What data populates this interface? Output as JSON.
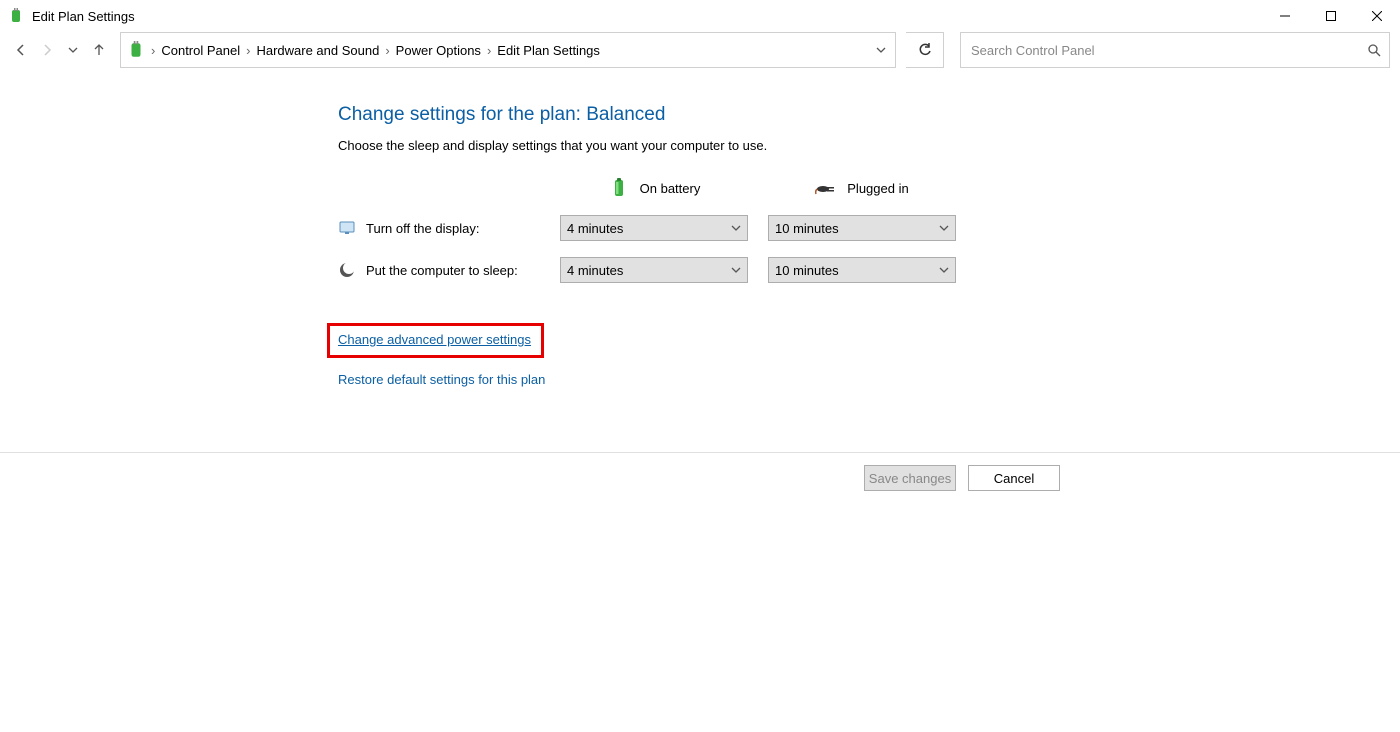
{
  "window": {
    "title": "Edit Plan Settings"
  },
  "breadcrumb": {
    "items": [
      "Control Panel",
      "Hardware and Sound",
      "Power Options",
      "Edit Plan Settings"
    ]
  },
  "search": {
    "placeholder": "Search Control Panel"
  },
  "page": {
    "heading": "Change settings for the plan: Balanced",
    "subheading": "Choose the sleep and display settings that you want your computer to use.",
    "col_battery": "On battery",
    "col_plugged": "Plugged in",
    "rows": [
      {
        "label": "Turn off the display:",
        "battery": "4 minutes",
        "plugged": "10 minutes"
      },
      {
        "label": "Put the computer to sleep:",
        "battery": "4 minutes",
        "plugged": "10 minutes"
      }
    ],
    "link_advanced": "Change advanced power settings",
    "link_restore": "Restore default settings for this plan"
  },
  "footer": {
    "save": "Save changes",
    "cancel": "Cancel"
  }
}
